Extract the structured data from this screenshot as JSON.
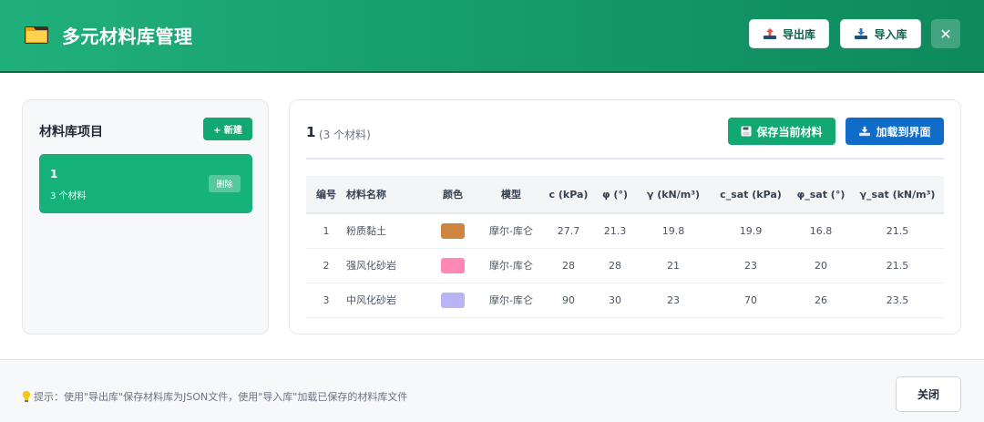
{
  "header": {
    "title": "多元材料库管理",
    "export_label": "导出库",
    "import_label": "导入库",
    "close_symbol": "✕",
    "icons": {
      "title": "folder-icon",
      "export": "tray-upload-icon",
      "import": "tray-download-icon",
      "close": "close-icon"
    }
  },
  "sidebar": {
    "title": "材料库项目",
    "new_label": "+ 新建",
    "items": [
      {
        "name": "1",
        "count_text": "3 个材料",
        "delete_label": "删除"
      }
    ]
  },
  "main": {
    "library_name": "1",
    "count_text": "(3 个材料)",
    "save_label": "保存当前材料",
    "load_label": "加载到界面",
    "icons": {
      "save": "floppy-disk-icon",
      "load": "tray-download-icon"
    }
  },
  "table": {
    "columns": [
      "编号",
      "材料名称",
      "颜色",
      "模型",
      "c (kPa)",
      "φ (°)",
      "γ (kN/m³)",
      "c_sat (kPa)",
      "φ_sat (°)",
      "γ_sat (kN/m³)"
    ],
    "rows": [
      {
        "id": "1",
        "name": "粉质黏土",
        "color": "#cd853f",
        "model": "摩尔-库仑",
        "c": "27.7",
        "phi": "21.3",
        "gamma": "19.8",
        "c_sat": "19.9",
        "phi_sat": "16.8",
        "gamma_sat": "21.5"
      },
      {
        "id": "2",
        "name": "强风化砂岩",
        "color": "#ff89b4",
        "model": "摩尔-库仑",
        "c": "28",
        "phi": "28",
        "gamma": "21",
        "c_sat": "23",
        "phi_sat": "20",
        "gamma_sat": "21.5"
      },
      {
        "id": "3",
        "name": "中风化砂岩",
        "color": "#b8b4f5",
        "model": "摩尔-库仑",
        "c": "90",
        "phi": "30",
        "gamma": "23",
        "c_sat": "70",
        "phi_sat": "26",
        "gamma_sat": "23.5"
      }
    ]
  },
  "footer": {
    "hint": "提示：使用\"导出库\"保存材料库为JSON文件，使用\"导入库\"加载已保存的材料库文件",
    "close_label": "关闭",
    "icons": {
      "hint": "lightbulb-icon"
    }
  },
  "colors": {
    "accent": "#16b27b",
    "primary_blue": "#0f6cc8",
    "header_start": "#20b07c",
    "header_end": "#0e8a5d"
  }
}
